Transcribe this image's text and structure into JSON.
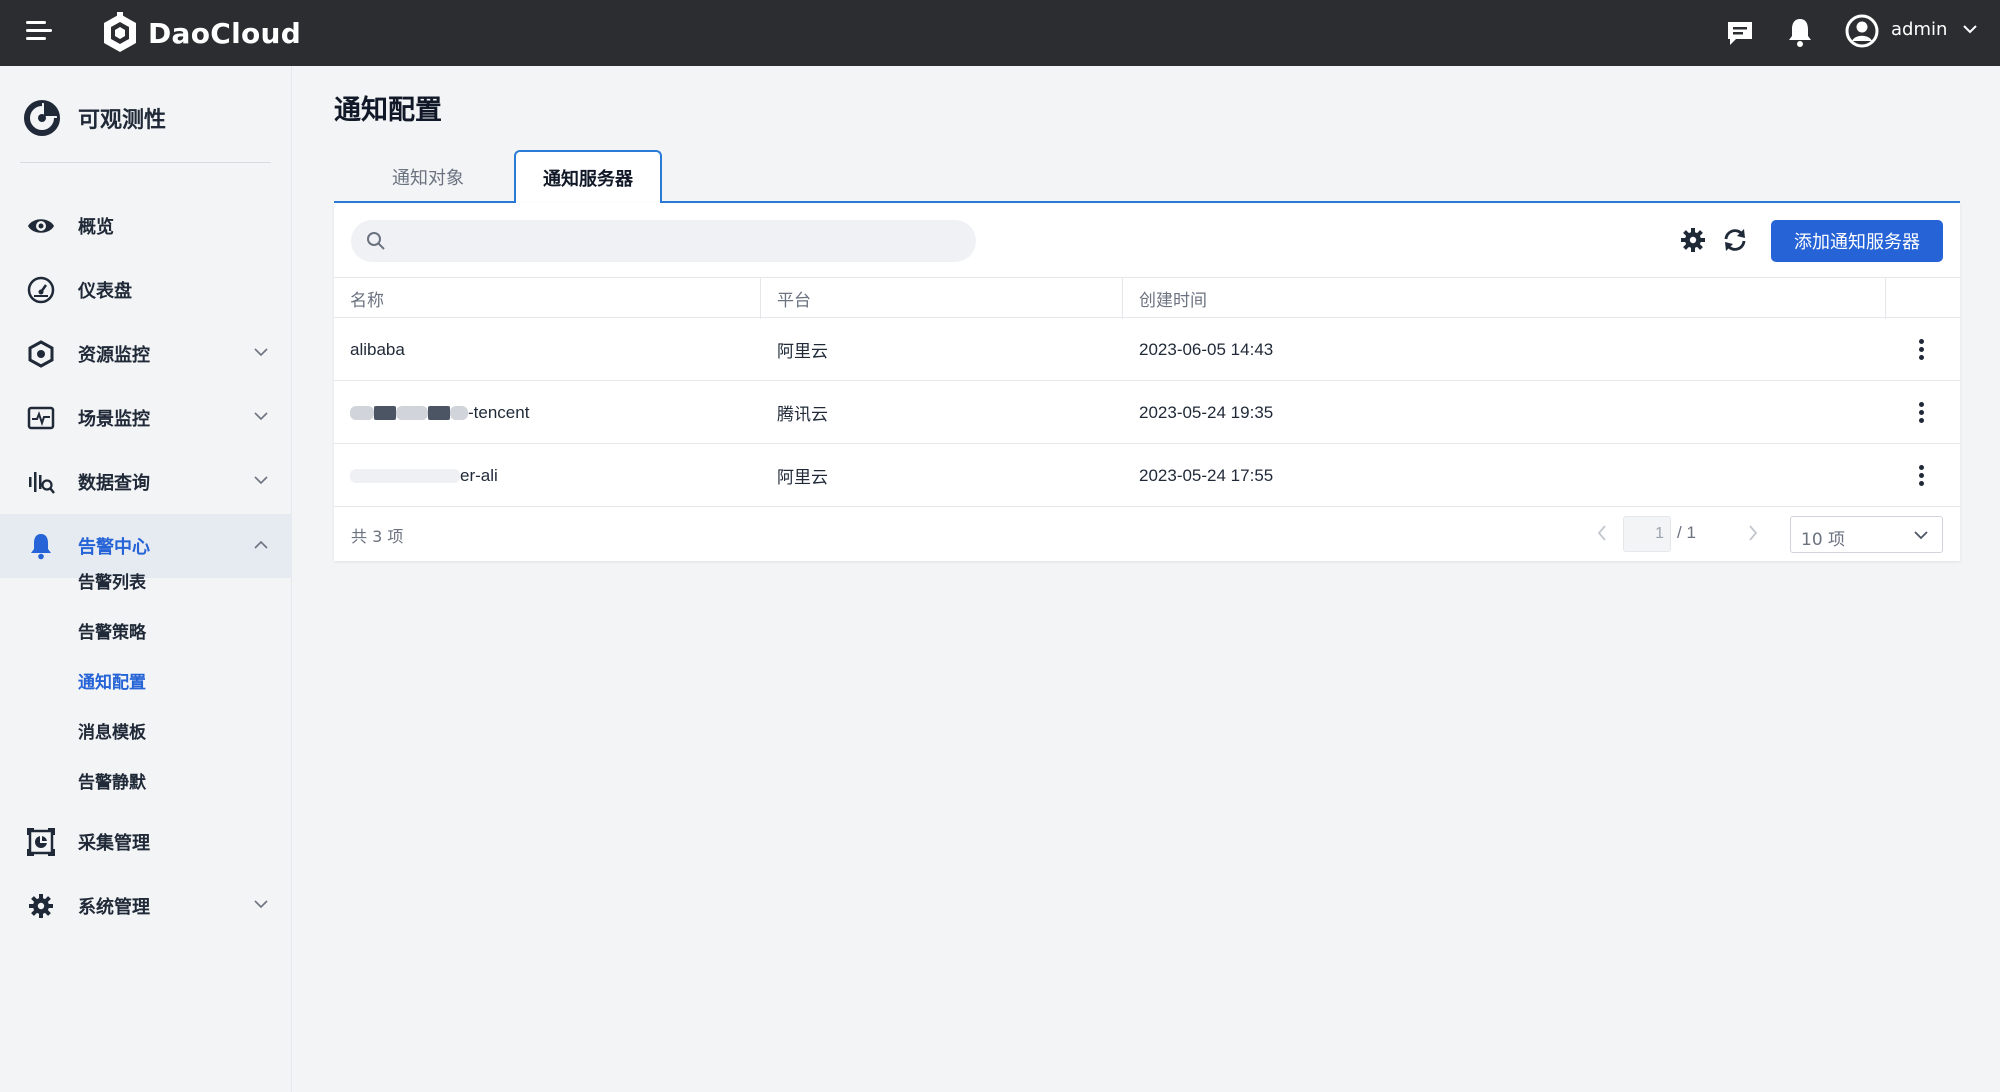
{
  "topbar": {
    "brand": "DaoCloud",
    "user": "admin"
  },
  "sidebar": {
    "module_title": "可观测性",
    "items": [
      {
        "label": "概览",
        "icon": "eye-icon"
      },
      {
        "label": "仪表盘",
        "icon": "dashboard-gauge-icon"
      },
      {
        "label": "资源监控",
        "icon": "resource-hexagon-icon"
      },
      {
        "label": "场景监控",
        "icon": "scene-monitor-icon"
      },
      {
        "label": "数据查询",
        "icon": "data-query-icon"
      },
      {
        "label": "告警中心",
        "icon": "bell-icon"
      },
      {
        "label": "采集管理",
        "icon": "collection-icon"
      },
      {
        "label": "系统管理",
        "icon": "gear-icon"
      }
    ],
    "sub_items": [
      "告警列表",
      "告警策略",
      "通知配置",
      "消息模板",
      "告警静默"
    ]
  },
  "page": {
    "title": "通知配置",
    "tabs": [
      "通知对象",
      "通知服务器"
    ],
    "active_tab": "通知服务器"
  },
  "toolbar": {
    "search_placeholder": "",
    "add_button": "添加通知服务器"
  },
  "table": {
    "columns": [
      "名称",
      "平台",
      "创建时间"
    ],
    "rows": [
      {
        "name": "alibaba",
        "platform": "阿里云",
        "created": "2023-06-05 14:43"
      },
      {
        "name": "-tencent",
        "platform": "腾讯云",
        "created": "2023-05-24 19:35"
      },
      {
        "name": "er-ali",
        "platform": "阿里云",
        "created": "2023-05-24 17:55"
      }
    ]
  },
  "pagination": {
    "total": "共 3 项",
    "current_page": "1",
    "page_total": "/ 1",
    "page_size": "10 项"
  },
  "colors": {
    "topbar_bg": "#2b2d31",
    "accent": "#2563d6"
  }
}
